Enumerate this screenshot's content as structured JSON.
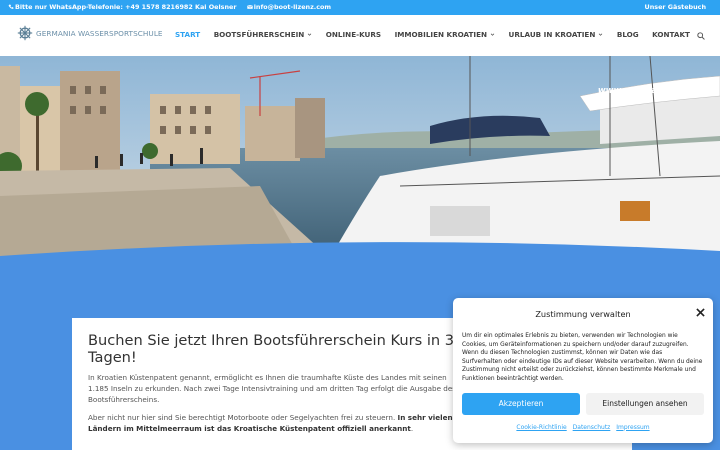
{
  "topbar": {
    "whatsapp": "Bitte nur WhatsApp-Telefonie: +49 1578 8216982 Kai Oelsner",
    "email": "info@boot-lizenz.com",
    "guestbook": "Unser Gästebuch"
  },
  "header": {
    "logo_text": "GERMANIA WASSERSPORTSCHULE",
    "nav": [
      {
        "label": "START",
        "dropdown": false
      },
      {
        "label": "BOOTSFÜHRERSCHEIN",
        "dropdown": true
      },
      {
        "label": "ONLINE-KURS",
        "dropdown": false
      },
      {
        "label": "IMMOBILIEN KROATIEN",
        "dropdown": true
      },
      {
        "label": "URLAUB IN KROATIEN",
        "dropdown": true
      },
      {
        "label": "BLOG",
        "dropdown": false
      },
      {
        "label": "KONTAKT",
        "dropdown": false
      }
    ]
  },
  "hero": {
    "watermark": "www.ankoracharter"
  },
  "main": {
    "heading": "Buchen Sie jetzt Ihren Bootsführerschein Kurs in 3 Tagen!",
    "para1": "In Kroatien Küstenpatent genannt, ermöglicht es Ihnen die traumhafte Küste des Landes mit seinen 1.185 Inseln zu erkunden. Nach zwei Tage Intensivtraining und am dritten Tag erfolgt die Ausgabe des Bootsführerscheins.",
    "para2_start": "Aber nicht nur hier sind Sie berechtigt Motorboote oder Segelyachten frei zu steuern. ",
    "para2_bold": "In sehr vielen Ländern im Mittelmeerraum ist das Kroatische Küstenpatent offiziell anerkannt",
    "para2_end": "."
  },
  "cookie": {
    "title": "Zustimmung verwalten",
    "text": "Um dir ein optimales Erlebnis zu bieten, verwenden wir Technologien wie Cookies, um Geräteinformationen zu speichern und/oder darauf zuzugreifen. Wenn du diesen Technologien zustimmst, können wir Daten wie das Surfverhalten oder eindeutige IDs auf dieser Website verarbeiten. Wenn du deine Zustimmung nicht erteilst oder zurückziehst, können bestimmte Merkmale und Funktionen beeinträchtigt werden.",
    "accept": "Akzeptieren",
    "settings": "Einstellungen ansehen",
    "links": [
      "Cookie-Richtlinie",
      "Datenschutz",
      "Impressum"
    ]
  },
  "colors": {
    "accent": "#2ea3f2",
    "background": "#4a90e2"
  }
}
